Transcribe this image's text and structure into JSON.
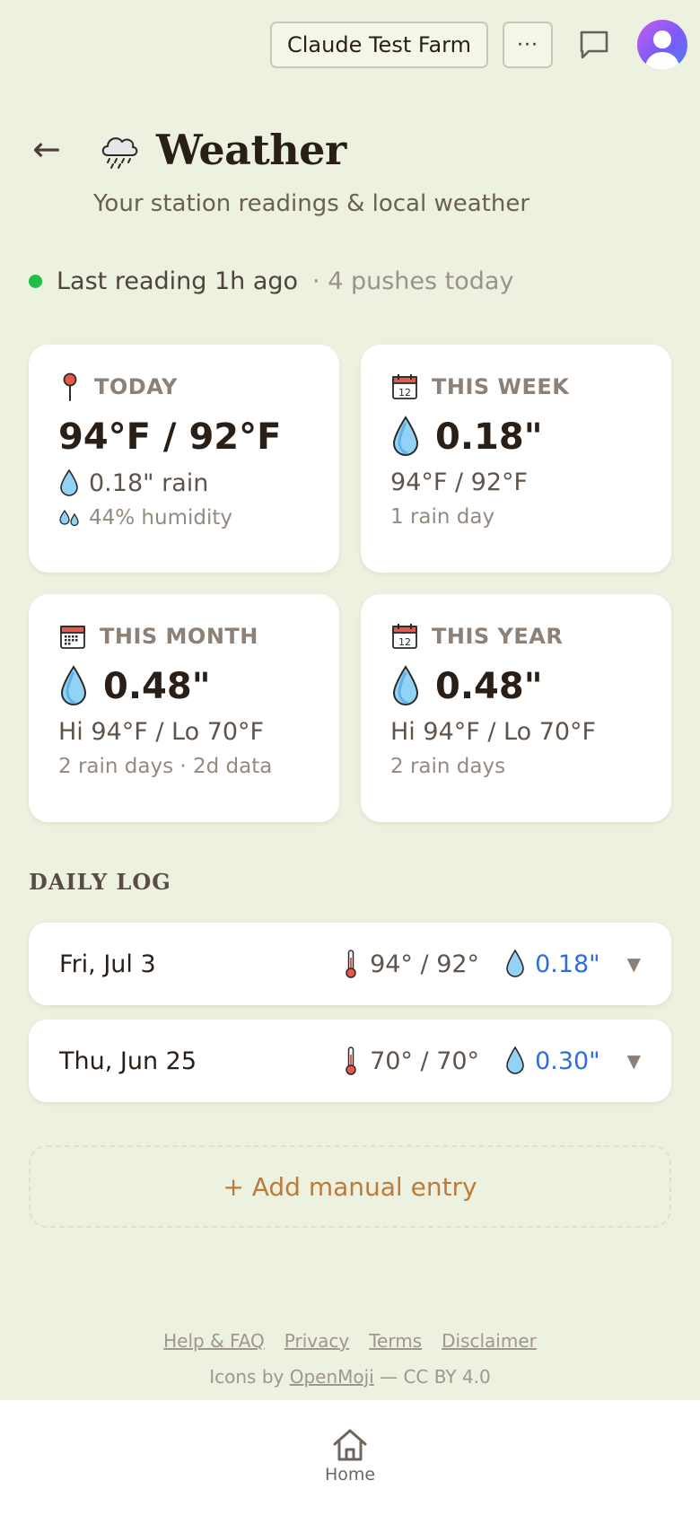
{
  "topbar": {
    "farm_name": "Claude Test Farm",
    "more_label": "···"
  },
  "header": {
    "back": "←",
    "title": "Weather",
    "subtitle": "Your station readings & local weather"
  },
  "status": {
    "reading": "Last reading 1h ago",
    "pushes": "· 4 pushes today"
  },
  "cards": {
    "today": {
      "label": "TODAY",
      "temps": "94°F / 92°F",
      "rain": "0.18\" rain",
      "humidity": "44% humidity"
    },
    "week": {
      "label": "THIS WEEK",
      "rain": "0.18\"",
      "temps": "94°F / 92°F",
      "days": "1 rain day"
    },
    "month": {
      "label": "THIS MONTH",
      "rain": "0.48\"",
      "temps": "Hi 94°F / Lo 70°F",
      "days": "2 rain days · 2d data"
    },
    "year": {
      "label": "THIS YEAR",
      "rain": "0.48\"",
      "temps": "Hi 94°F / Lo 70°F",
      "days": "2 rain days"
    }
  },
  "daily_log": {
    "title": "DAILY LOG",
    "rows": [
      {
        "date": "Fri, Jul 3",
        "temps": "94° / 92°",
        "rain": "0.18\""
      },
      {
        "date": "Thu, Jun 25",
        "temps": "70° / 70°",
        "rain": "0.30\""
      }
    ],
    "chevron": "▼"
  },
  "add_entry": "+ Add manual entry",
  "footer": {
    "links": [
      "Help & FAQ",
      "Privacy",
      "Terms",
      "Disclaimer"
    ],
    "credit_prefix": "Icons by ",
    "credit_link": "OpenMoji",
    "credit_suffix": " — CC BY 4.0"
  },
  "nav": {
    "home": "Home"
  },
  "colors": {
    "background": "#edf1df",
    "status_dot": "#1fbd4a",
    "rain_blue": "#2e6ee0",
    "add_entry": "#bd7b3a"
  },
  "icons": [
    "more-icon",
    "chat-icon",
    "avatar-icon",
    "back-arrow-icon",
    "rain-cloud-icon",
    "pushpin-icon",
    "calendar-icon",
    "droplet-icon",
    "humidity-icon",
    "thermometer-icon",
    "chevron-down-icon",
    "home-icon"
  ]
}
